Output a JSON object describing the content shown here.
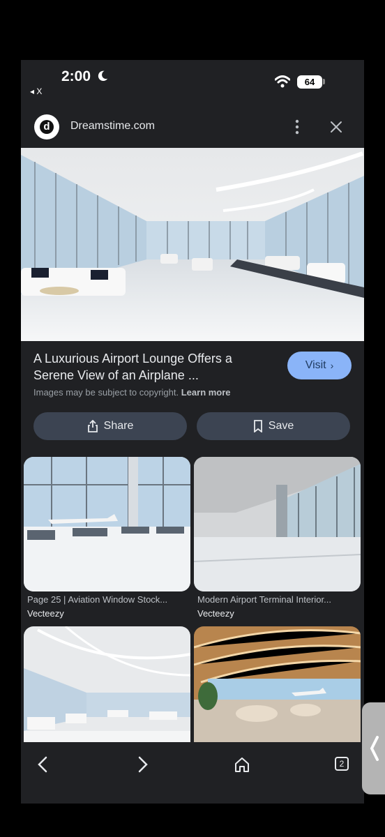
{
  "status_bar": {
    "time": "2:00",
    "back_label": "◂ X",
    "battery": "64"
  },
  "source": {
    "name": "Dreamstime.com",
    "logo_letter": "d"
  },
  "hero": {
    "icon": "airport-lounge-image"
  },
  "details": {
    "title": "A Luxurious Airport Lounge Offers a Serene View of an Airplane ...",
    "visit_label": "Visit",
    "copyright_text": "Images may be subject to copyright.",
    "learn_more": "Learn more",
    "share_label": "Share",
    "save_label": "Save"
  },
  "related": [
    {
      "caption": "Page 25 | Aviation Window Stock...",
      "source": "Vecteezy"
    },
    {
      "caption": "Modern Airport Terminal Interior...",
      "source": "Vecteezy"
    }
  ],
  "bottom_nav": {
    "tab_count": "2"
  },
  "colors": {
    "background": "#202124",
    "accent": "#8ab4f8",
    "button": "#3c4452"
  }
}
